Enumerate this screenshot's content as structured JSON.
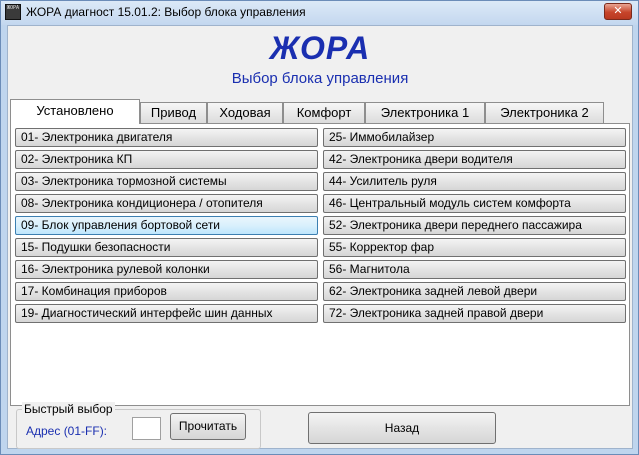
{
  "window": {
    "title": "ЖОРА диагност 15.01.2:  Выбор блока управления",
    "icon_text": "ЖОРА",
    "close_label": "✕"
  },
  "header": {
    "brand": "ЖОРА",
    "subtitle": "Выбор блока управления"
  },
  "tabs": [
    {
      "label": "Установлено",
      "active": true
    },
    {
      "label": "Привод",
      "active": false
    },
    {
      "label": "Ходовая",
      "active": false
    },
    {
      "label": "Комфорт",
      "active": false
    },
    {
      "label": "Электроника 1",
      "active": false
    },
    {
      "label": "Электроника 2",
      "active": false
    }
  ],
  "modules_left": [
    {
      "label": "01- Электроника двигателя"
    },
    {
      "label": "02- Электроника КП"
    },
    {
      "label": "03- Электроника тормозной системы"
    },
    {
      "label": "08- Электроника кондиционера / отопителя"
    },
    {
      "label": "09- Блок управления бортовой сети",
      "hover": true
    },
    {
      "label": "15- Подушки безопасности"
    },
    {
      "label": "16- Электроника рулевой колонки"
    },
    {
      "label": "17- Комбинация приборов"
    },
    {
      "label": "19- Диагностический интерфейс шин данных"
    }
  ],
  "modules_right": [
    {
      "label": "25- Иммобилайзер"
    },
    {
      "label": "42- Электроника двери водителя"
    },
    {
      "label": "44- Усилитель руля"
    },
    {
      "label": "46- Центральный модуль систем комфорта"
    },
    {
      "label": "52- Электроника двери переднего пассажира"
    },
    {
      "label": "55- Корректор фар"
    },
    {
      "label": "56- Магнитола"
    },
    {
      "label": "62- Электроника задней левой двери"
    },
    {
      "label": "72- Электроника задней правой двери"
    }
  ],
  "quick_select": {
    "group_label": "Быстрый выбор",
    "address_label": "Адрес (01-FF):",
    "address_value": "",
    "read_label": "Прочитать"
  },
  "footer": {
    "back_label": "Назад"
  }
}
